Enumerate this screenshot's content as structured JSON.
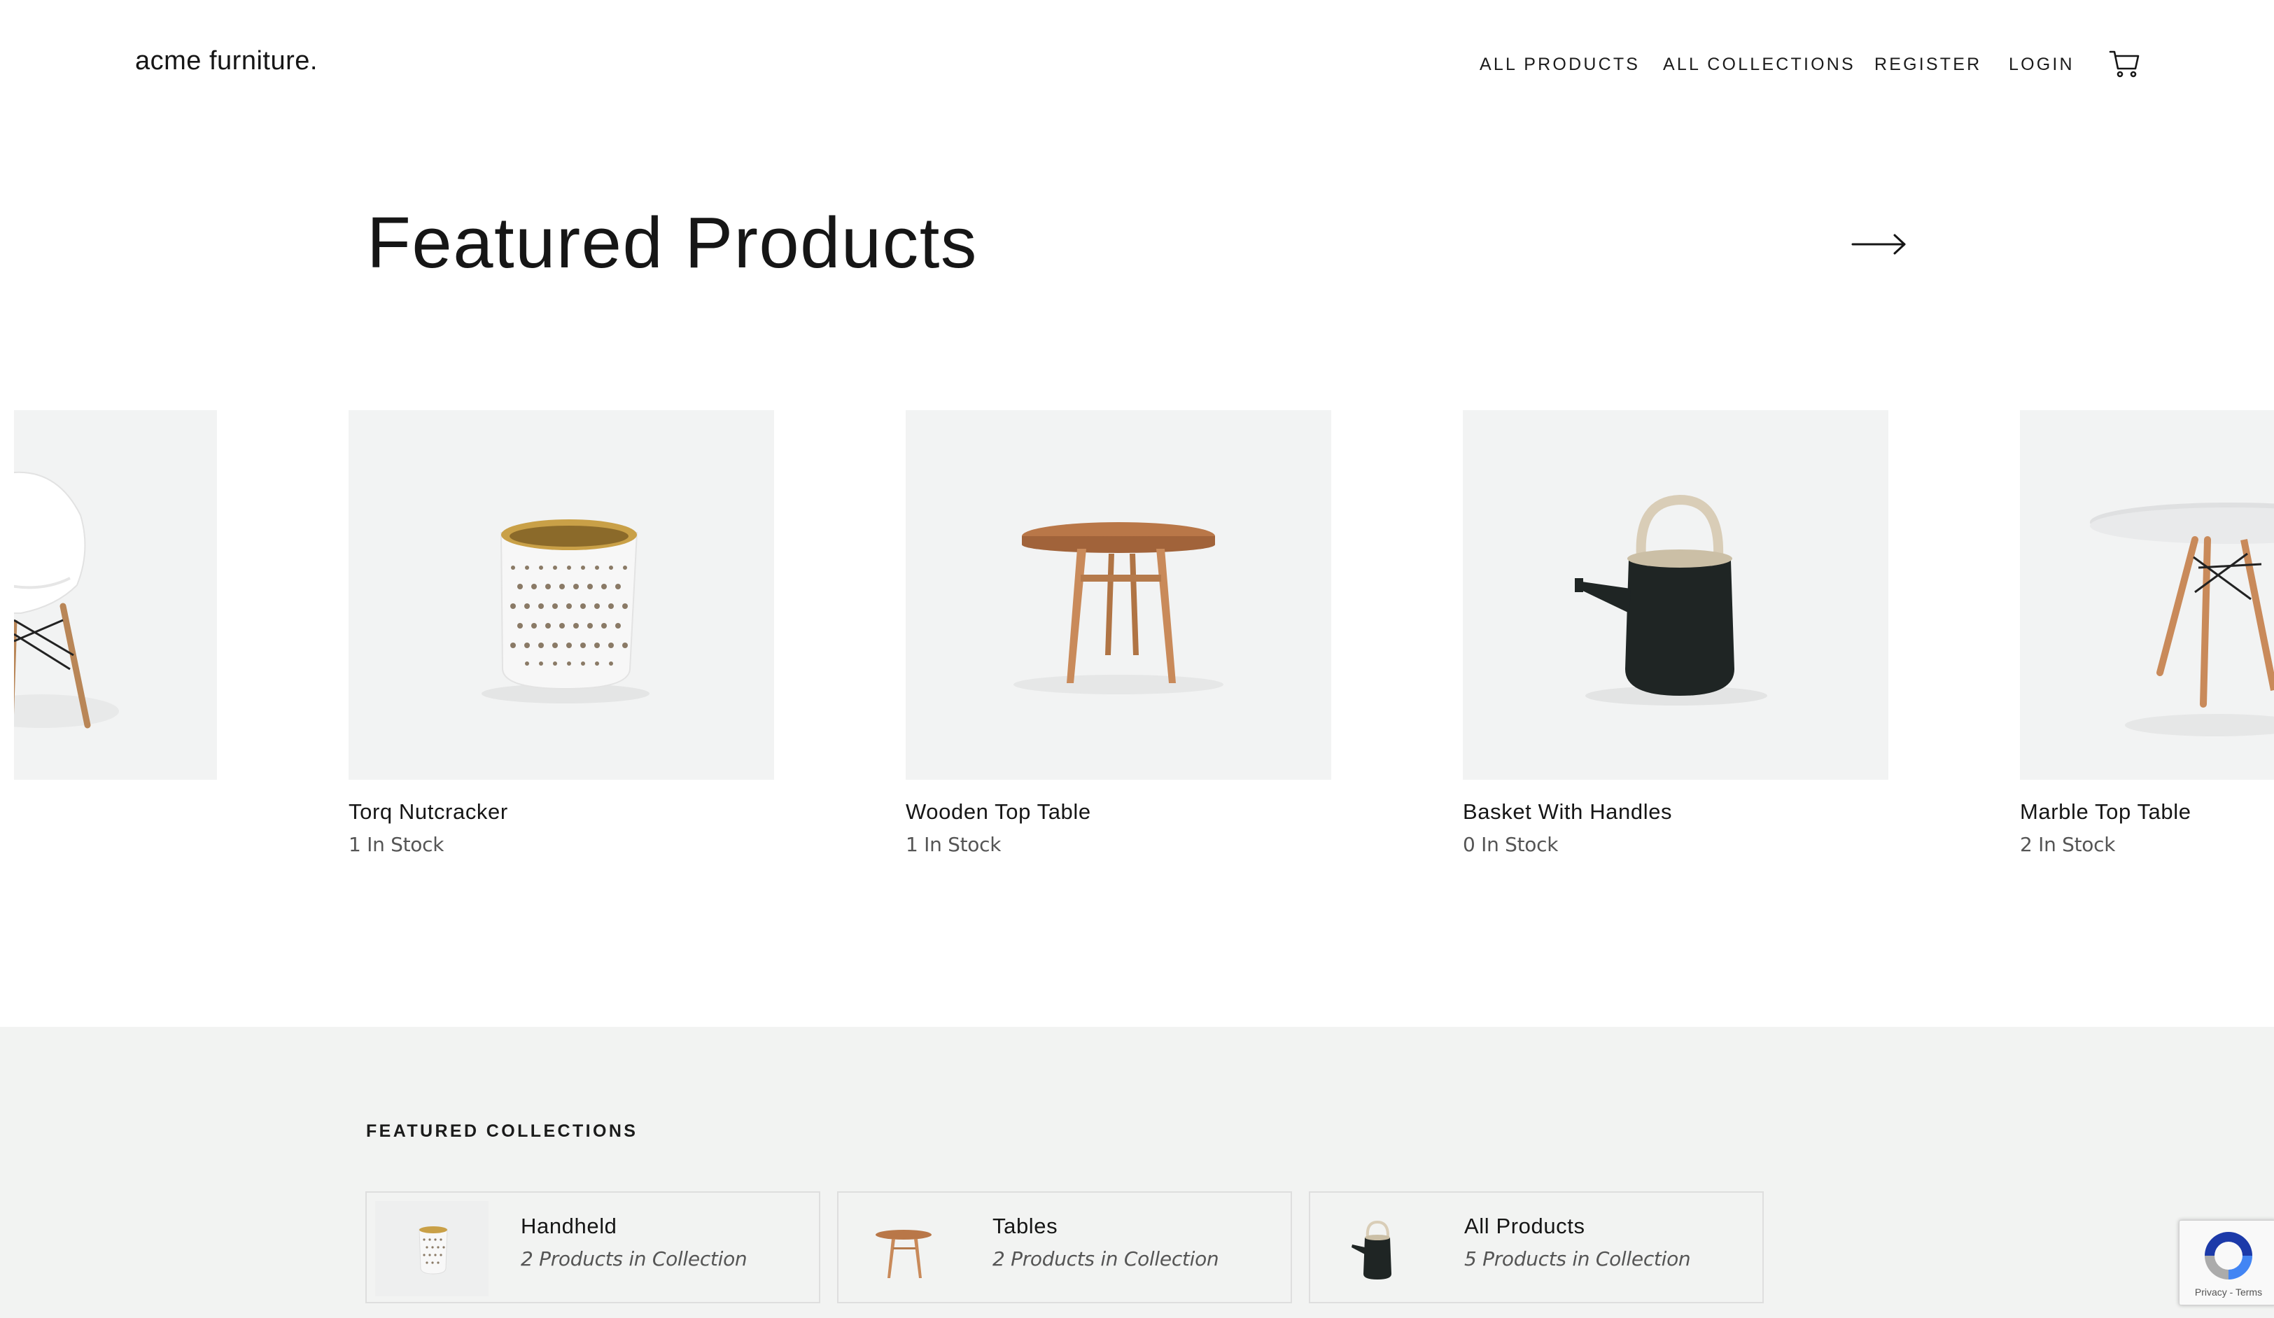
{
  "header": {
    "brand": "acme furniture.",
    "nav": [
      "ALL PRODUCTS",
      "ALL COLLECTIONS",
      "REGISTER",
      "LOGIN"
    ]
  },
  "featured": {
    "title": "Featured Products",
    "products": [
      {
        "name": "",
        "stock": ""
      },
      {
        "name": "Torq Nutcracker",
        "stock": "1 In Stock"
      },
      {
        "name": "Wooden Top Table",
        "stock": "1 In Stock"
      },
      {
        "name": "Basket With Handles",
        "stock": "0 In Stock"
      },
      {
        "name": "Marble Top Table",
        "stock": "2 In Stock"
      }
    ]
  },
  "collections": {
    "label": "FEATURED COLLECTIONS",
    "items": [
      {
        "name": "Handheld",
        "count": "2 Products in Collection"
      },
      {
        "name": "Tables",
        "count": "2 Products in Collection"
      },
      {
        "name": "All Products",
        "count": "5 Products in Collection"
      }
    ]
  },
  "recaptcha": {
    "links": "Privacy - Terms"
  },
  "colors": {
    "text": "#161616",
    "muted": "#555555",
    "card_bg": "#f2f3f3",
    "section_bg": "#f2f3f2",
    "basket_body": "#1f2524",
    "wood": "#c98a5a"
  },
  "icons": [
    "cart-icon",
    "arrow-right-icon",
    "recaptcha-icon"
  ]
}
